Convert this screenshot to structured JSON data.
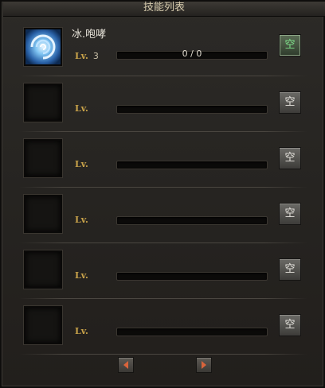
{
  "window": {
    "title": "技能列表"
  },
  "skills": [
    {
      "name": "冰.咆哮",
      "lv_label": "Lv.",
      "level": "3",
      "progress": "0 / 0",
      "button": "空",
      "active": true
    },
    {
      "name": "",
      "lv_label": "Lv.",
      "level": "",
      "progress": "",
      "button": "空",
      "active": false
    },
    {
      "name": "",
      "lv_label": "Lv.",
      "level": "",
      "progress": "",
      "button": "空",
      "active": false
    },
    {
      "name": "",
      "lv_label": "Lv.",
      "level": "",
      "progress": "",
      "button": "空",
      "active": false
    },
    {
      "name": "",
      "lv_label": "Lv.",
      "level": "",
      "progress": "",
      "button": "空",
      "active": false
    },
    {
      "name": "",
      "lv_label": "Lv.",
      "level": "",
      "progress": "",
      "button": "空",
      "active": false
    }
  ],
  "icons": {
    "skill_0": "ice-vortex-icon",
    "prev": "arrow-left-icon",
    "next": "arrow-right-icon"
  },
  "colors": {
    "lv_label": "#c9a34a",
    "active_button_text": "#7fe28b"
  }
}
